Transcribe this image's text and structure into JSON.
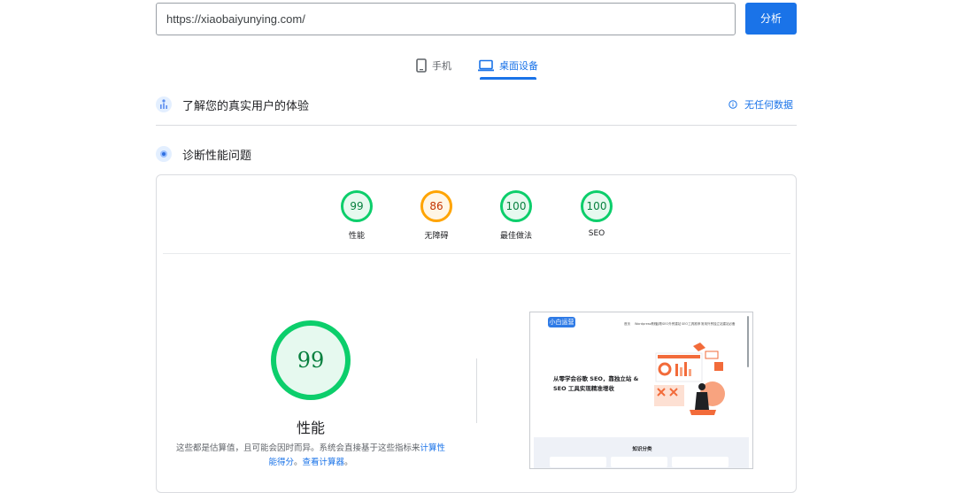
{
  "search": {
    "url_value": "https://xiaobaiyunying.com/",
    "analyze_label": "分析"
  },
  "tabs": {
    "mobile_label": "手机",
    "desktop_label": "桌面设备",
    "active": "desktop"
  },
  "field_data": {
    "title": "了解您的真实用户的体验",
    "status": "无任何数据"
  },
  "diagnose": {
    "title": "诊断性能问题"
  },
  "scores": [
    {
      "label": "性能",
      "value": "99",
      "rating": "pass"
    },
    {
      "label": "无障碍",
      "value": "86",
      "rating": "average"
    },
    {
      "label": "最佳做法",
      "value": "100",
      "rating": "pass"
    },
    {
      "label": "SEO",
      "value": "100",
      "rating": "pass"
    }
  ],
  "performance": {
    "score": "99",
    "label": "性能",
    "desc_prefix": "这些都是估算值，且可能会因时而异。系统会直接基于这些指标来",
    "desc_link1": "计算性能得分",
    "desc_sep": "。",
    "desc_link2": "查看计算器",
    "desc_suffix": "。"
  },
  "thumbnail": {
    "logo_text": "小白运营",
    "nav": [
      "首页",
      "Wordpress教程",
      "谷歌SEO外贸建站",
      "SEO工具推荐",
      "常用外贸独立站建站必备"
    ],
    "headline": "从零学会谷歌 SEO，靠独立站 & SEO 工具实现精准增收",
    "section_title": "知识分类"
  },
  "colors": {
    "accent": "#1a73e8",
    "pass": "#0cce6b",
    "average": "#ffa400"
  }
}
